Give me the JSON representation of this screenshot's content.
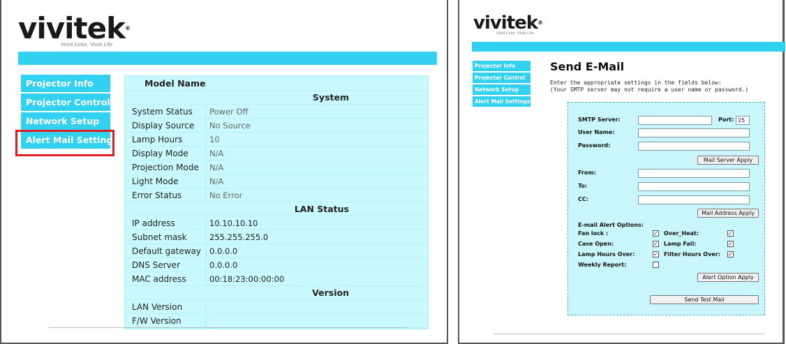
{
  "left": {
    "logo": "vivitek",
    "logo_tagline": "Vivid Color, Vivid Life",
    "nav": [
      "Projector Info",
      "Projector Control",
      "Network Setup",
      "Alert Mail Settings"
    ],
    "table": {
      "model_name_label": "Model Name",
      "model_name_value": "",
      "system_header": "System",
      "system_rows": [
        {
          "key": "System Status",
          "value": "Power Off"
        },
        {
          "key": "Display Source",
          "value": "No Source"
        },
        {
          "key": "Lamp Hours",
          "value": "10"
        },
        {
          "key": "Display Mode",
          "value": "N/A"
        },
        {
          "key": "Projection Mode",
          "value": "N/A"
        },
        {
          "key": "Light Mode",
          "value": "N/A"
        },
        {
          "key": "Error Status",
          "value": "No Error"
        }
      ],
      "lan_header": "LAN Status",
      "lan_rows": [
        {
          "key": "IP address",
          "value": "10.10.10.10"
        },
        {
          "key": "Subnet mask",
          "value": "255.255.255.0"
        },
        {
          "key": "Default gateway",
          "value": "0.0.0.0"
        },
        {
          "key": "DNS Server",
          "value": "0.0.0.0"
        },
        {
          "key": "MAC address",
          "value": "00:18:23:00:00:00"
        }
      ],
      "version_header": "Version",
      "version_rows": [
        {
          "key": "LAN Version",
          "value": ""
        },
        {
          "key": "F/W Version",
          "value": ""
        }
      ]
    }
  },
  "right": {
    "logo": "vivitek",
    "logo_tagline": "Vivid Color, Vivid Life",
    "nav": [
      "Projector Info",
      "Projector Control",
      "Network Setup",
      "Alert Mail Settings"
    ],
    "title": "Send E-Mail",
    "desc_line1": "Enter the appropriate settings in the fields below:",
    "desc_line2": "(Your SMTP server may not require a user name or password.)",
    "form": {
      "smtp_label": "SMTP Server:",
      "port_label": "Port:",
      "port_value": "25",
      "user_label": "User Name:",
      "password_label": "Password:",
      "mail_server_apply": "Mail Server Apply",
      "from_label": "From:",
      "to_label": "To:",
      "cc_label": "CC:",
      "mail_address_apply": "Mail Address Apply",
      "options_title": "E-mail Alert Options:",
      "options": [
        {
          "label": "Fan lock :",
          "checked": true
        },
        {
          "label": "Over_Heat:",
          "checked": true
        },
        {
          "label": "Case Open:",
          "checked": true
        },
        {
          "label": "Lamp Fail:",
          "checked": true
        },
        {
          "label": "Lamp Hours Over:",
          "checked": true
        },
        {
          "label": "Filter Hours Over:",
          "checked": true
        },
        {
          "label": "Weekly Report:",
          "checked": false
        }
      ],
      "alert_option_apply": "Alert Option Apply",
      "send_test_mail": "Send Test Mail"
    }
  },
  "colors": {
    "accent": "#33d1f0",
    "table_bg": "#c9f8fd",
    "highlight": "#e01b22"
  }
}
